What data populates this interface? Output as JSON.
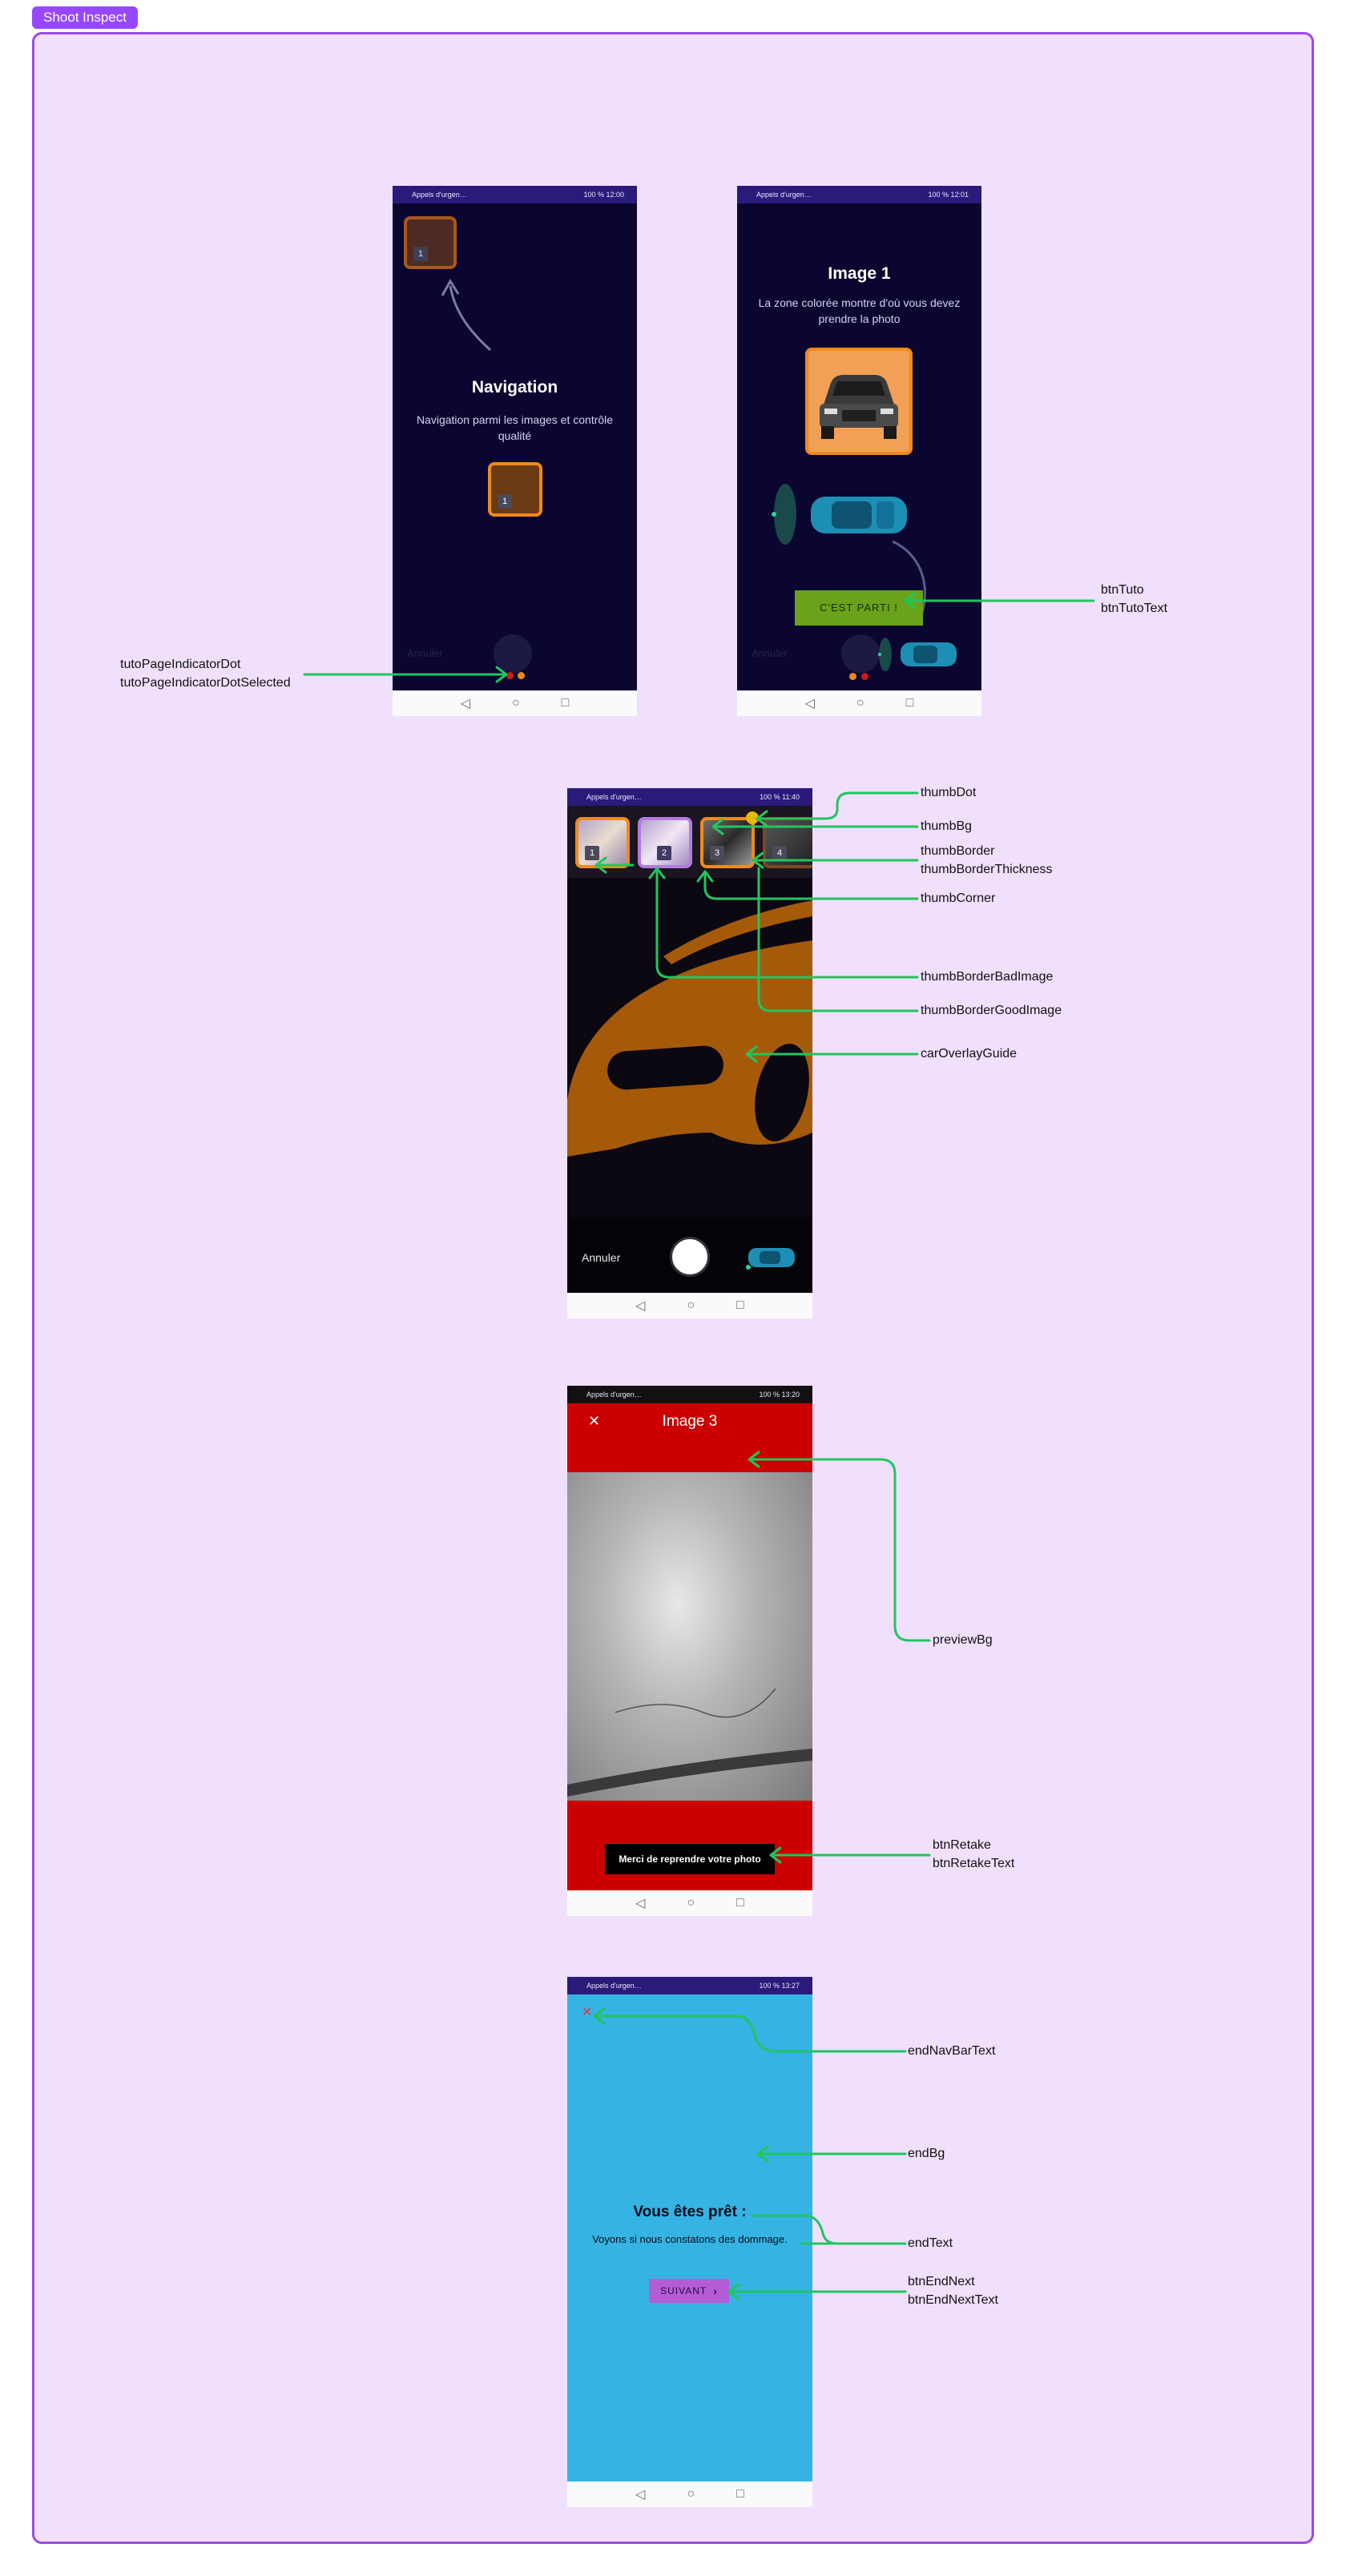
{
  "frame_tag": "Shoot Inspect",
  "colors": {
    "frame_bg": "#f0e0fd",
    "frame_border": "#9b4ae6",
    "tag_bg": "#9747ff",
    "tuto_bg": "#0a0630",
    "status_bar": "#2a1a7a",
    "thumb_border": "#f08a1c",
    "btn_tuto": "#6aa21a",
    "preview_bg": "#cc0000",
    "end_bg": "#35b3e3",
    "btn_end_next": "#b45cd6",
    "annotation_line": "#22c55e",
    "car_overlay": "#a55a0a",
    "dot_selected": "#f08a1c",
    "dot": "#cc1a1a"
  },
  "screen1": {
    "status_left": "Appels d'urgen…",
    "status_right": "100 % 12:00",
    "title": "Navigation",
    "subtitle": "Navigation parmi les images et contrôle qualité",
    "thumb_top_number": "1",
    "thumb_center_number": "1",
    "cancel": "Annuler",
    "nav_back": "◁",
    "nav_home": "○",
    "nav_recent": "□"
  },
  "screen2": {
    "status_left": "Appels d'urgen…",
    "status_right": "100 % 12:01",
    "title": "Image 1",
    "subtitle": "La zone colorée montre d'où vous devez prendre la photo",
    "button": "C'EST PARTI !",
    "cancel": "Annuler",
    "nav_back": "◁",
    "nav_home": "○",
    "nav_recent": "□"
  },
  "screen3": {
    "status_left": "Appels d'urgen…",
    "status_right": "100 % 11:40",
    "thumbs": [
      "1",
      "2",
      "3",
      "4"
    ],
    "cancel": "Annuler",
    "nav_back": "◁",
    "nav_home": "○",
    "nav_recent": "□"
  },
  "screen4": {
    "status_left": "Appels d'urgen…",
    "status_right": "100 % 13:20",
    "close": "✕",
    "title": "Image 3",
    "button": "Merci de reprendre votre photo",
    "nav_back": "◁",
    "nav_home": "○",
    "nav_recent": "□"
  },
  "screen5": {
    "status_left": "Appels d'urgen…",
    "status_right": "100 % 13:27",
    "close": "✕",
    "title": "Vous êtes prêt :",
    "subtitle": "Voyons si nous constatons des dommage.",
    "button": "SUIVANT",
    "button_icon": "chevron-right-icon",
    "nav_back": "◁",
    "nav_home": "○",
    "nav_recent": "□"
  },
  "annotations": {
    "tuto_page_indicator_dot": "tutoPageIndicatorDot",
    "tuto_page_indicator_dot_selected": "tutoPageIndicatorDotSelected",
    "btn_tuto": "btnTuto",
    "btn_tuto_text": "btnTutoText",
    "thumb_dot": "thumbDot",
    "thumb_bg": "thumbBg",
    "thumb_border": "thumbBorder",
    "thumb_border_thickness": "thumbBorderThickness",
    "thumb_corner": "thumbCorner",
    "thumb_border_bad_image": "thumbBorderBadImage",
    "thumb_border_good_image": "thumbBorderGoodImage",
    "car_overlay_guide": "carOverlayGuide",
    "preview_bg": "previewBg",
    "btn_retake": "btnRetake",
    "btn_retake_text": "btnRetakeText",
    "end_nav_bar_text": "endNavBarText",
    "end_bg": "endBg",
    "end_text": "endText",
    "btn_end_next": "btnEndNext",
    "btn_end_next_text": "btnEndNextText"
  }
}
